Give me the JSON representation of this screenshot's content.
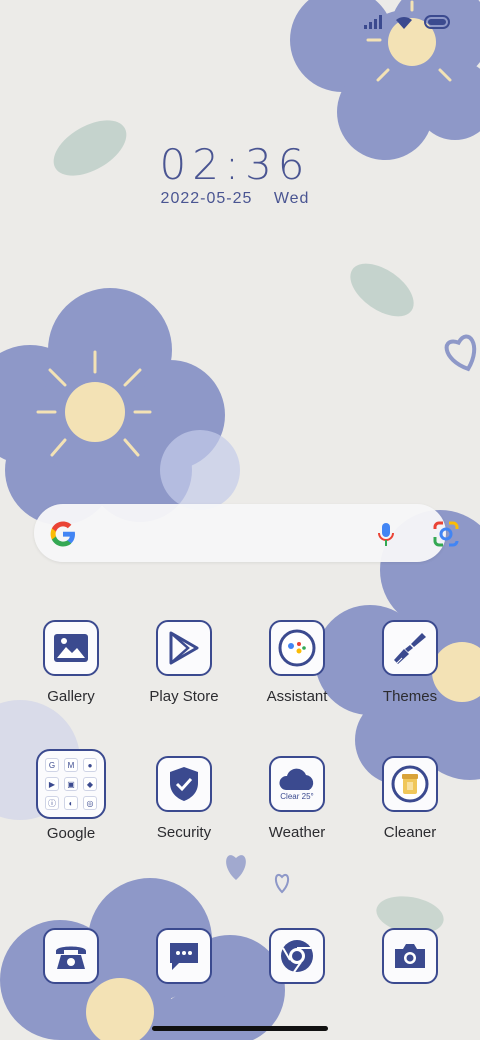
{
  "status_bar": {
    "signal_icon": "signal-icon",
    "wifi_icon": "wifi-icon",
    "battery_icon": "battery-icon"
  },
  "clock": {
    "time": "02:36",
    "date": "2022-05-25",
    "weekday": "Wed"
  },
  "search": {
    "logo": "google-g-icon",
    "mic_icon": "mic-icon",
    "lens_icon": "lens-icon"
  },
  "apps_row1": [
    {
      "label": "Gallery",
      "icon": "gallery-icon"
    },
    {
      "label": "Play Store",
      "icon": "play-store-icon"
    },
    {
      "label": "Assistant",
      "icon": "assistant-icon"
    },
    {
      "label": "Themes",
      "icon": "brush-icon"
    }
  ],
  "apps_row2": [
    {
      "label": "Google",
      "icon": "folder-icon"
    },
    {
      "label": "Security",
      "icon": "shield-icon"
    },
    {
      "label": "Weather",
      "icon": "cloud-icon",
      "badge": "Clear 25°"
    },
    {
      "label": "Cleaner",
      "icon": "cleaner-icon"
    }
  ],
  "dock": [
    {
      "icon": "phone-icon"
    },
    {
      "icon": "messages-icon"
    },
    {
      "icon": "chrome-icon"
    },
    {
      "icon": "camera-icon"
    }
  ],
  "colors": {
    "accent": "#3b4a8f",
    "flower": "#8e98c8",
    "sun": "#f3e2b5",
    "leaf": "#b9cbc4"
  }
}
